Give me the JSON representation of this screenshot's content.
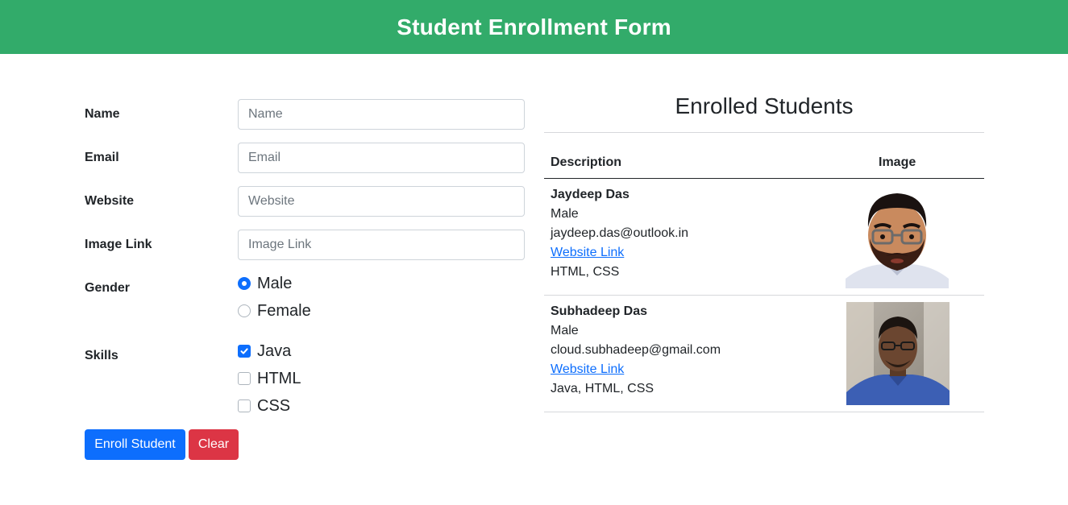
{
  "header": {
    "title": "Student Enrollment Form"
  },
  "form": {
    "name": {
      "label": "Name",
      "placeholder": "Name"
    },
    "email": {
      "label": "Email",
      "placeholder": "Email"
    },
    "website": {
      "label": "Website",
      "placeholder": "Website"
    },
    "image_link": {
      "label": "Image Link",
      "placeholder": "Image Link"
    },
    "gender": {
      "label": "Gender",
      "options": [
        "Male",
        "Female"
      ],
      "selected": "Male"
    },
    "skills": {
      "label": "Skills",
      "options": [
        "Java",
        "HTML",
        "CSS"
      ],
      "checked": [
        "Java"
      ]
    },
    "enroll_button": "Enroll Student",
    "clear_button": "Clear"
  },
  "enrolled": {
    "title": "Enrolled Students",
    "columns": [
      "Description",
      "Image"
    ],
    "students": [
      {
        "name": "Jaydeep Das",
        "gender": "Male",
        "email": "jaydeep.das@outlook.in",
        "website_label": "Website Link",
        "skills": "HTML, CSS",
        "image": "cartoon-avatar"
      },
      {
        "name": "Subhadeep Das",
        "gender": "Male",
        "email": "cloud.subhadeep@gmail.com",
        "website_label": "Website Link",
        "skills": "Java, HTML, CSS",
        "image": "photo-avatar"
      }
    ]
  },
  "colors": {
    "header_bg": "#32ab6a",
    "primary": "#0d6efd",
    "danger": "#dc3545"
  }
}
